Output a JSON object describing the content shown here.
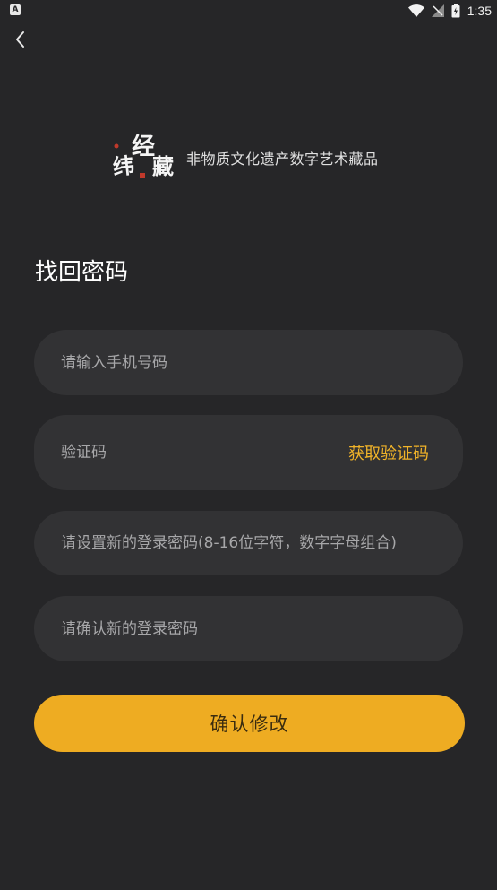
{
  "status_bar": {
    "time": "1:35",
    "app_icon_letter": "A"
  },
  "header": {
    "back_icon": "chevron-left-icon"
  },
  "brand": {
    "logo_text": "纬经藏",
    "slogan": "非物质文化遗产数字艺术藏品"
  },
  "page": {
    "title": "找回密码"
  },
  "form": {
    "phone_placeholder": "请输入手机号码",
    "code_placeholder": "验证码",
    "get_code_label": "获取验证码",
    "new_password_placeholder": "请设置新的登录密码(8-16位字符，数字字母组合)",
    "confirm_password_placeholder": "请确认新的登录密码",
    "submit_label": "确认修改"
  },
  "colors": {
    "background": "#262628",
    "field_background": "#323234",
    "accent": "#eeac22",
    "link": "#f0b329",
    "placeholder": "#a7a7a9"
  }
}
